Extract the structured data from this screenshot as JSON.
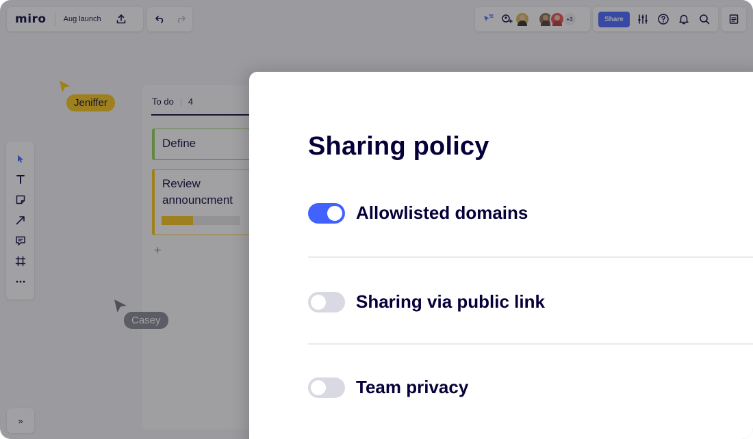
{
  "app": {
    "logo": "miro",
    "board_name": "Aug launch"
  },
  "topbar": {
    "share_label": "Share",
    "collaborators_more": "+3",
    "icons": [
      "upload-icon",
      "undo-icon",
      "redo-icon",
      "cursor-filter-icon",
      "add-user-icon",
      "settings-sliders-icon",
      "help-icon",
      "bell-icon",
      "search-icon",
      "notes-icon"
    ]
  },
  "toolbar": {
    "tools": [
      "select-icon",
      "text-icon",
      "sticky-note-icon",
      "arrow-icon",
      "comment-icon",
      "frame-icon",
      "more-icon"
    ],
    "collapse_label": "»"
  },
  "kanban": {
    "column_title": "To do",
    "column_count": "4",
    "cards": [
      {
        "title": "Define",
        "color": "#8fd14f"
      },
      {
        "title": "Review announcment",
        "color": "#fac710",
        "progress": 0.4
      }
    ],
    "add_label": "+"
  },
  "cursors": [
    {
      "name": "Jeniffer",
      "color": "#fac710"
    },
    {
      "name": "Casey",
      "color": "#7d7d87"
    }
  ],
  "modal": {
    "title": "Sharing policy",
    "options": [
      {
        "label": "Allowlisted domains",
        "enabled": true
      },
      {
        "label": "Sharing via public link",
        "enabled": false
      },
      {
        "label": "Team privacy",
        "enabled": false
      }
    ]
  },
  "colors": {
    "accent": "#4262ff",
    "text": "#050038",
    "toggle_off": "#d9d9e3"
  }
}
